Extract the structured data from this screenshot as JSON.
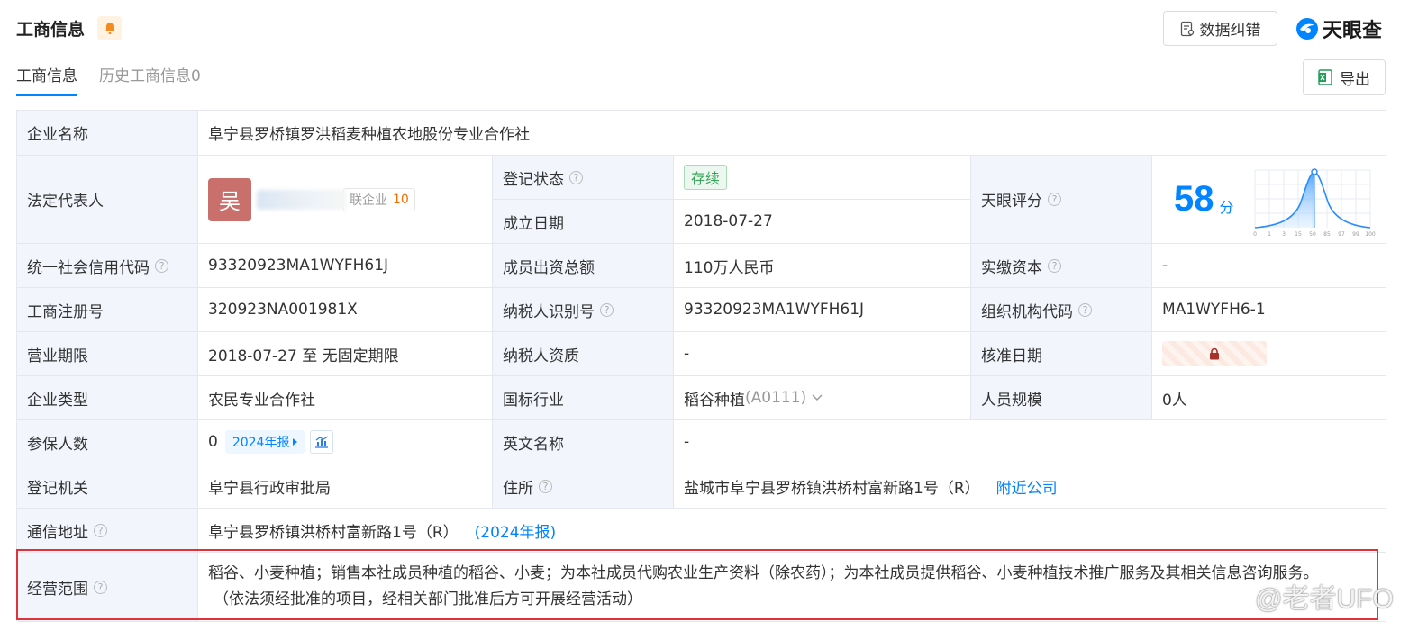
{
  "header": {
    "title": "工商信息",
    "fix_label": "数据纠错",
    "logo_text": "天眼查"
  },
  "tabs": [
    {
      "label": "工商信息"
    },
    {
      "label": "历史工商信息0"
    }
  ],
  "export_label": "导出",
  "table": {
    "company_name_label": "企业名称",
    "company_name": "阜宁县罗桥镇罗洪稻麦种植农地股份专业合作社",
    "legal_rep_label": "法定代表人",
    "legal_rep_avatar": "吴",
    "legal_rep_related": "联企业",
    "legal_rep_related_count": "10",
    "reg_status_label": "登记状态",
    "reg_status": "存续",
    "founded_label": "成立日期",
    "founded": "2018-07-27",
    "tianyan_score_label": "天眼评分",
    "score": "58",
    "score_unit": "分",
    "score_axis": [
      "0",
      "1",
      "3",
      "15",
      "50",
      "85",
      "97",
      "99",
      "100"
    ],
    "credit_code_label": "统一社会信用代码",
    "credit_code": "93320923MA1WYFH61J",
    "member_capital_label": "成员出资总额",
    "member_capital": "110万人民币",
    "paid_capital_label": "实缴资本",
    "paid_capital": "-",
    "reg_no_label": "工商注册号",
    "reg_no": "320923NA001981X",
    "taxpayer_id_label": "纳税人识别号",
    "taxpayer_id": "93320923MA1WYFH61J",
    "org_code_label": "组织机构代码",
    "org_code": "MA1WYFH6-1",
    "term_label": "营业期限",
    "term": "2018-07-27 至 无固定期限",
    "taxpayer_qual_label": "纳税人资质",
    "taxpayer_qual": "-",
    "approval_date_label": "核准日期",
    "company_type_label": "企业类型",
    "company_type": "农民专业合作社",
    "industry_label": "国标行业",
    "industry": "稻谷种植",
    "industry_code": "(A0111)",
    "staff_size_label": "人员规模",
    "staff_size": "0人",
    "insured_label": "参保人数",
    "insured": "0",
    "insured_year": "2024年报",
    "english_name_label": "英文名称",
    "english_name": "-",
    "authority_label": "登记机关",
    "authority": "阜宁县行政审批局",
    "residence_label": "住所",
    "residence": "盐城市阜宁县罗桥镇洪桥村富新路1号（R）",
    "nearby_label": "附近公司",
    "mail_address_label": "通信地址",
    "mail_address": "阜宁县罗桥镇洪桥村富新路1号（R）",
    "mail_year": "(2024年报)",
    "scope_label": "经营范围",
    "scope_line1": "稻谷、小麦种植；销售本社成员种植的稻谷、小麦；为本社成员代购农业生产资料（除农药）；为本社成员提供稻谷、小麦种植技术推广服务及其相关信息咨询服务。",
    "scope_line2": "（依法须经批准的项目，经相关部门批准后方可开展经营活动）"
  },
  "watermark": "@老者UFO",
  "colors": {
    "accent": "#0084ff",
    "label_bg": "#f2f6fc",
    "highlight_border": "#e0323a",
    "status_green": "#3aa55a"
  }
}
